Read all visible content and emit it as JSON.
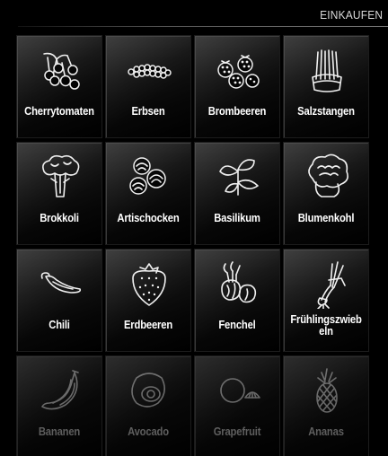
{
  "header": {
    "title": "EINKAUFEN"
  },
  "items": [
    {
      "label": "Cherrytomaten",
      "icon": "cherry-tomatoes-icon",
      "enabled": true
    },
    {
      "label": "Erbsen",
      "icon": "peas-icon",
      "enabled": true
    },
    {
      "label": "Brombeeren",
      "icon": "blackberries-icon",
      "enabled": true
    },
    {
      "label": "Salzstangen",
      "icon": "pretzel-sticks-icon",
      "enabled": true
    },
    {
      "label": "Brokkoli",
      "icon": "broccoli-icon",
      "enabled": true
    },
    {
      "label": "Artischocken",
      "icon": "artichoke-icon",
      "enabled": true
    },
    {
      "label": "Basilikum",
      "icon": "basil-icon",
      "enabled": true
    },
    {
      "label": "Blumenkohl",
      "icon": "cauliflower-icon",
      "enabled": true
    },
    {
      "label": "Chili",
      "icon": "chili-icon",
      "enabled": true
    },
    {
      "label": "Erdbeeren",
      "icon": "strawberry-icon",
      "enabled": true
    },
    {
      "label": "Fenchel",
      "icon": "fennel-icon",
      "enabled": true
    },
    {
      "label": "Frühlingszwiebeln",
      "icon": "spring-onion-icon",
      "enabled": true
    },
    {
      "label": "Bananen",
      "icon": "banana-icon",
      "enabled": false
    },
    {
      "label": "Avocado",
      "icon": "avocado-icon",
      "enabled": false
    },
    {
      "label": "Grapefruit",
      "icon": "grapefruit-icon",
      "enabled": false
    },
    {
      "label": "Ananas",
      "icon": "pineapple-icon",
      "enabled": false
    }
  ]
}
